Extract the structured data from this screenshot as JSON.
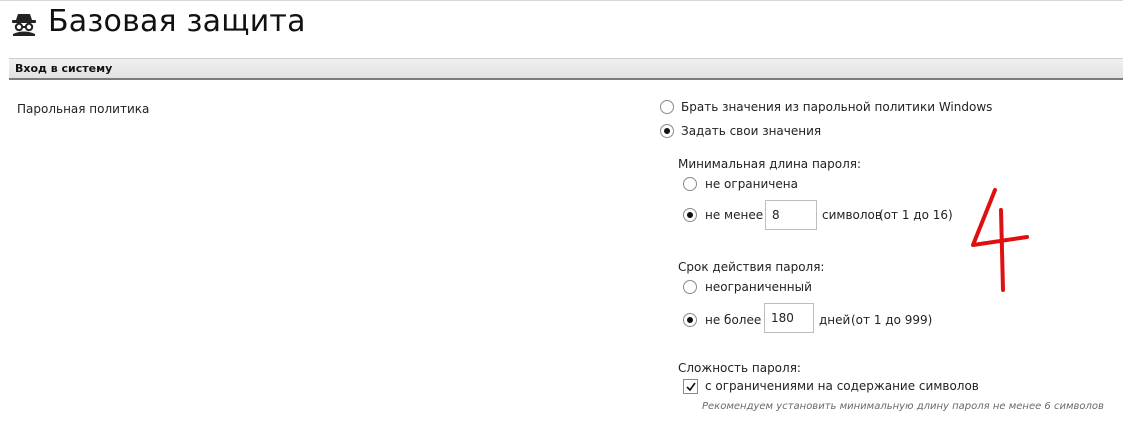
{
  "page": {
    "title": "Базовая защита",
    "title_icon": "spy-icon"
  },
  "section": {
    "title": "Вход в систему"
  },
  "password_policy": {
    "label": "Парольная политика",
    "source_options": [
      {
        "label": "Брать значения из парольной политики Windows",
        "selected": false
      },
      {
        "label": "Задать свои значения",
        "selected": true
      }
    ],
    "min_length": {
      "header": "Минимальная длина пароля:",
      "unlimited_label": "не ограничена",
      "unlimited_selected": false,
      "at_least_label": "не менее",
      "at_least_selected": true,
      "value": "8",
      "unit_label": "символов",
      "range_label": "(от 1 до 16)"
    },
    "expiry": {
      "header": "Срок действия пароля:",
      "unlimited_label": "неограниченный",
      "unlimited_selected": false,
      "at_most_label": "не более",
      "at_most_selected": true,
      "value": "180",
      "unit_label": "дней",
      "range_label": "(от 1 до 999)"
    },
    "complexity": {
      "header": "Сложность пароля:",
      "checkbox_label": "с ограничениями на содержание символов",
      "checked": true,
      "hint": "Рекомендуем установить минимальную длину пароля не менее 6 символов"
    }
  },
  "annotation": {
    "text": "4",
    "color": "#e01010"
  }
}
